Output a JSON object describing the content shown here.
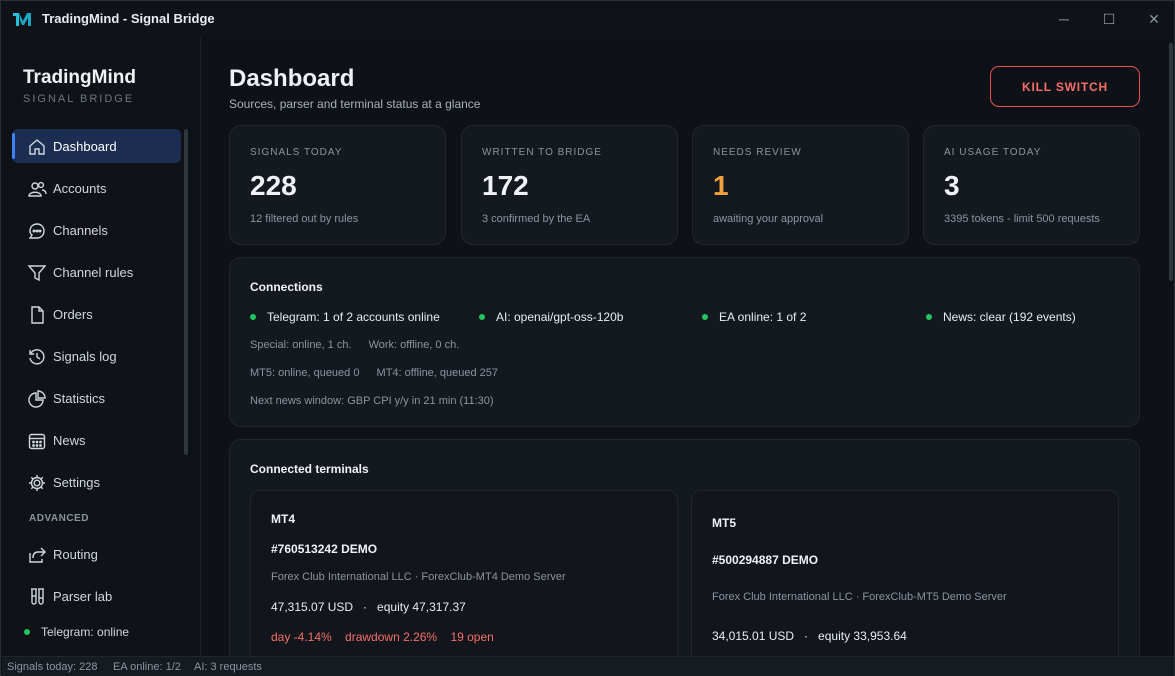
{
  "window": {
    "title": "TradingMind - Signal Bridge",
    "controls": {
      "minimize": "─",
      "maximize": "☐",
      "close": "✕"
    }
  },
  "sidebar": {
    "brand_title": "TradingMind",
    "brand_subtitle": "SIGNAL BRIDGE",
    "items": [
      {
        "label": "Dashboard",
        "icon": "home-icon",
        "active": true
      },
      {
        "label": "Accounts",
        "icon": "users-icon"
      },
      {
        "label": "Channels",
        "icon": "chat-icon"
      },
      {
        "label": "Channel rules",
        "icon": "filter-icon"
      },
      {
        "label": "Orders",
        "icon": "document-icon"
      },
      {
        "label": "Signals log",
        "icon": "history-icon"
      },
      {
        "label": "Statistics",
        "icon": "pie-chart-icon"
      },
      {
        "label": "News",
        "icon": "calendar-icon"
      },
      {
        "label": "Settings",
        "icon": "gear-icon"
      }
    ],
    "advanced_heading": "ADVANCED",
    "advanced_items": [
      {
        "label": "Routing",
        "icon": "share-icon"
      },
      {
        "label": "Parser lab",
        "icon": "flask-icon"
      }
    ],
    "status": "Telegram: online"
  },
  "header": {
    "title": "Dashboard",
    "subtitle": "Sources, parser and terminal status at a glance",
    "kill_switch": "KILL SWITCH"
  },
  "stats": [
    {
      "label": "SIGNALS TODAY",
      "value": "228",
      "note": "12 filtered out by rules"
    },
    {
      "label": "WRITTEN TO BRIDGE",
      "value": "172",
      "note": "3 confirmed by the EA"
    },
    {
      "label": "NEEDS REVIEW",
      "value": "1",
      "note": "awaiting your approval"
    },
    {
      "label": "AI USAGE TODAY",
      "value": "3",
      "note": "3395 tokens - limit 500 requests"
    }
  ],
  "connections": {
    "title": "Connections",
    "items": [
      "Telegram: 1 of 2 accounts online",
      "AI: openai/gpt-oss-120b",
      "EA online: 1 of 2",
      "News: clear (192 events)"
    ],
    "telegram_detail": [
      "Special: online, 1 ch.",
      "Work: offline, 0 ch."
    ],
    "terminal_detail": [
      "MT5: online, queued 0",
      "MT4: offline, queued 257"
    ],
    "news_detail": "Next news window: GBP CPI y/y in 21 min (11:30)"
  },
  "terminals": {
    "title": "Connected terminals",
    "list": [
      {
        "name": "MT4",
        "account": "#760513242  DEMO",
        "server": "Forex Club International LLC · ForexClub-MT4 Demo Server",
        "balance": "47,315.07 USD   ·   equity 47,317.37",
        "day": "day -4.14%",
        "drawdown": "drawdown 2.26%",
        "open": "19 open"
      },
      {
        "name": "MT5",
        "account": "#500294887  DEMO",
        "server": "Forex Club International LLC · ForexClub-MT5 Demo Server",
        "balance": "34,015.01 USD   ·   equity 33,953.64"
      }
    ]
  },
  "statusbar": {
    "signals": "Signals today: 228",
    "ea": "EA online: 1/2",
    "ai": "AI: 3 requests"
  },
  "colors": {
    "accent": "#3b82f6",
    "online": "#22c55e",
    "warning": "#f0a33a",
    "danger": "#f47067",
    "logo": "#22c3d8"
  }
}
